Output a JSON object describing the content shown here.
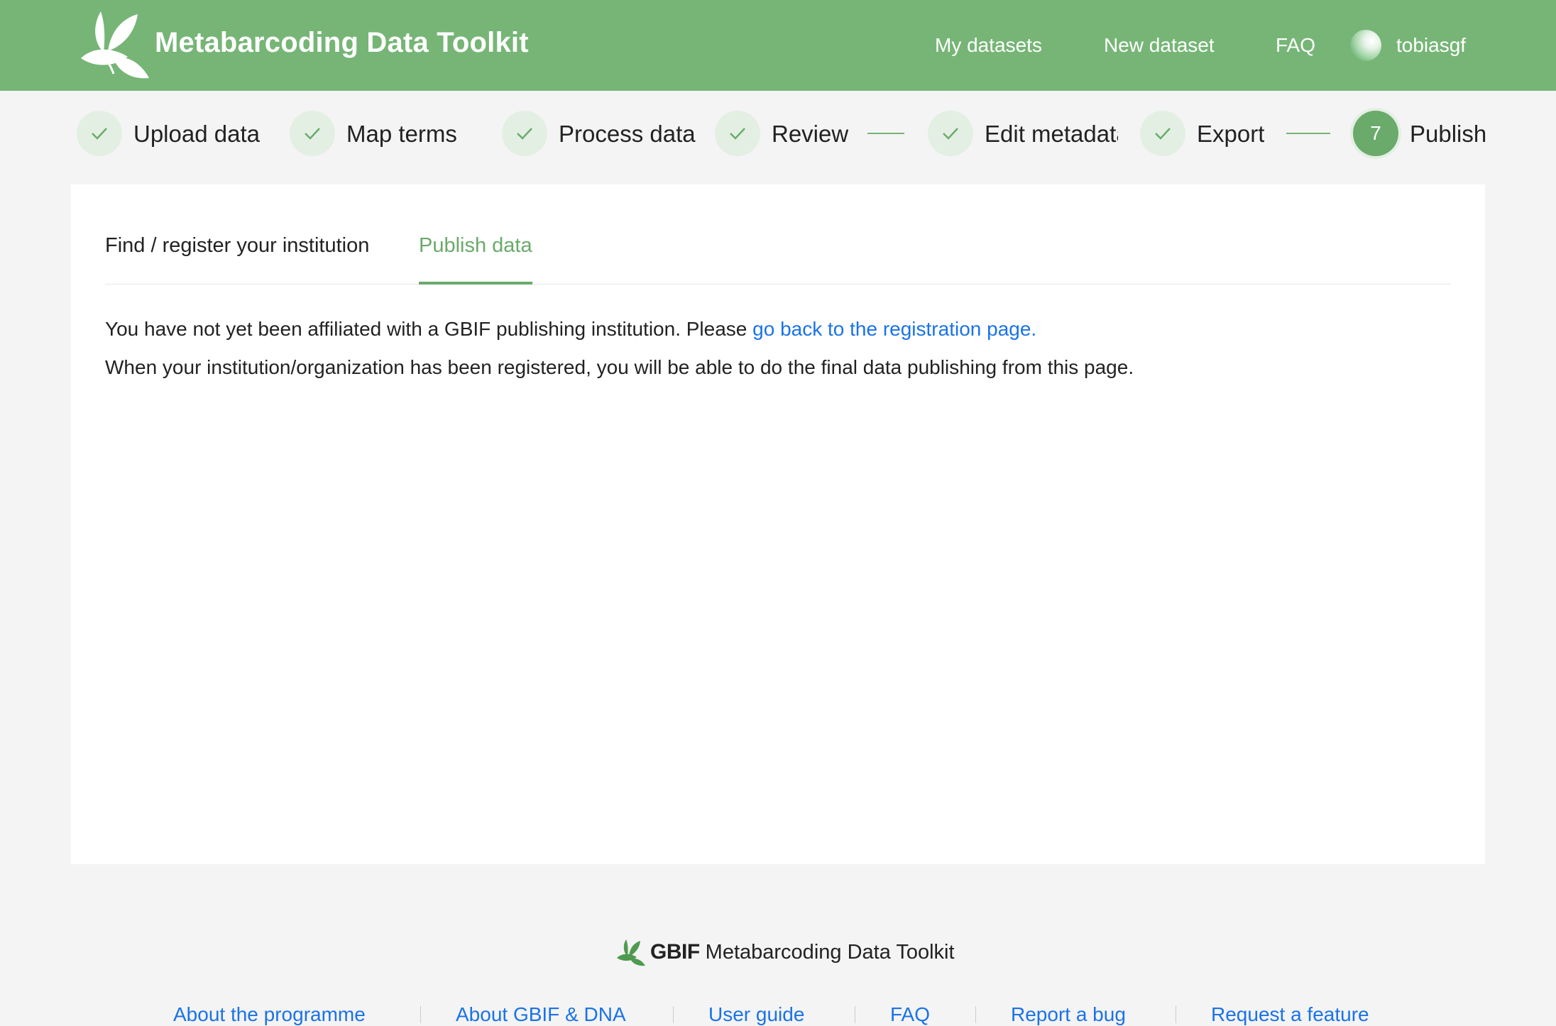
{
  "header": {
    "title": "Metabarcoding Data Toolkit",
    "nav": [
      "My datasets",
      "New dataset",
      "FAQ"
    ],
    "username": "tobiasgf"
  },
  "steps": [
    {
      "label": "Upload data",
      "status": "done"
    },
    {
      "label": "Map terms",
      "status": "done"
    },
    {
      "label": "Process data",
      "status": "done"
    },
    {
      "label": "Review",
      "status": "done"
    },
    {
      "label": "Edit metadata",
      "status": "done"
    },
    {
      "label": "Export",
      "status": "done"
    },
    {
      "label": "Publish",
      "status": "active",
      "number": "7"
    }
  ],
  "tabs": [
    {
      "label": "Find / register your institution",
      "active": false
    },
    {
      "label": "Publish data",
      "active": true
    }
  ],
  "message": {
    "line1_text": "You have not yet been affiliated with a GBIF publishing institution. Please",
    "line1_link": "go back to the registration page.",
    "line2_text": "When your institution/organization has been registered, you will be able to do the final data publishing from this page."
  },
  "footer": {
    "brand": "GBIF",
    "title": "Metabarcoding Data Toolkit",
    "links": [
      "About the programme",
      "About GBIF & DNA",
      "User guide",
      "FAQ",
      "Report a bug",
      "Request a feature"
    ]
  },
  "colors": {
    "brand_green": "#76b576",
    "accent_green": "#6aaa6a",
    "link_blue": "#1a73e8"
  }
}
